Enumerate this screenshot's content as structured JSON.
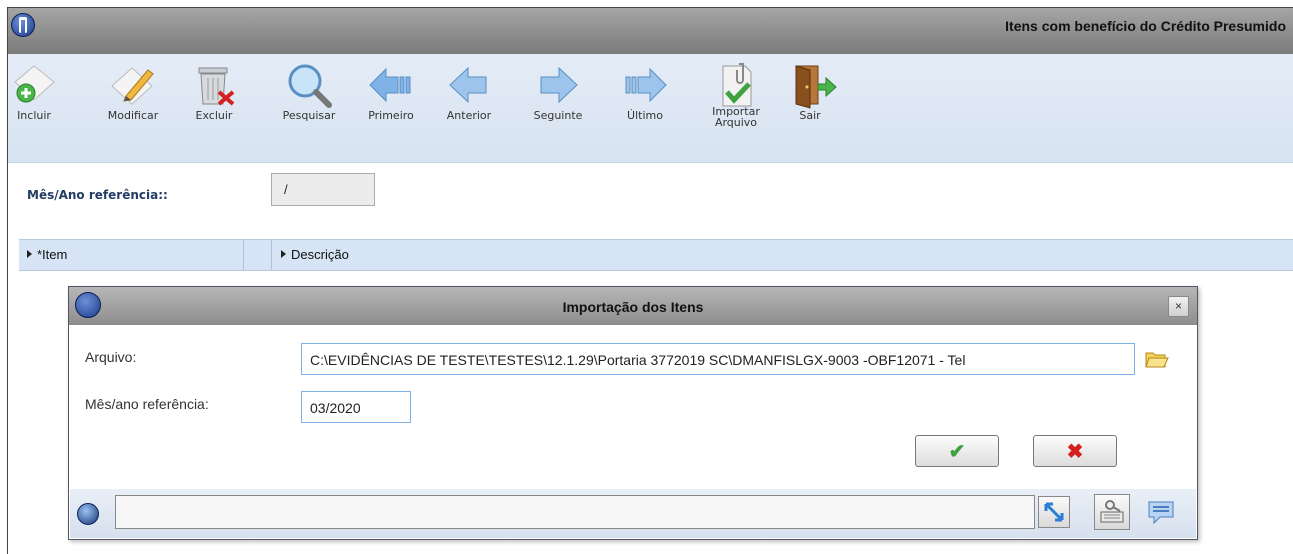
{
  "window": {
    "title": "Itens com benefício do Crédito Presumido"
  },
  "toolbar": {
    "buttons": [
      {
        "label": "Incluir",
        "icon": "add-icon"
      },
      {
        "label": "Modificar",
        "icon": "pencil-icon"
      },
      {
        "label": "Excluir",
        "icon": "trash-icon"
      },
      {
        "label": "Pesquisar",
        "icon": "magnifier-icon"
      },
      {
        "label": "Primeiro",
        "icon": "arrow-first-icon"
      },
      {
        "label": "Anterior",
        "icon": "arrow-left-icon"
      },
      {
        "label": "Seguinte",
        "icon": "arrow-right-icon"
      },
      {
        "label": "Último",
        "icon": "arrow-last-icon"
      },
      {
        "label": "Importar",
        "label2": "Arquivo",
        "icon": "import-file-icon"
      },
      {
        "label": "Sair",
        "icon": "exit-door-icon"
      }
    ]
  },
  "form": {
    "ref_label": "Mês/Ano referência::",
    "ref_value": "/"
  },
  "grid": {
    "columns": [
      "*Item",
      "Descrição"
    ]
  },
  "dialog": {
    "title": "Importação dos Itens",
    "close": "×",
    "file_label": "Arquivo:",
    "file_value": "C:\\EVIDÊNCIAS DE TESTE\\TESTES\\12.1.29\\Portaria 3772019 SC\\DMANFISLGX-9003 -OBF12071 - Tel",
    "month_label": "Mês/ano referência:",
    "month_value": "03/2020",
    "ok_icon": "✔",
    "cancel_icon": "✖"
  },
  "colors": {
    "accent": "#233d64",
    "toolbar_bg": "#dce6f2",
    "grid_header": "#d6e4f5",
    "ok": "#3fa23f",
    "cancel": "#d42020"
  }
}
